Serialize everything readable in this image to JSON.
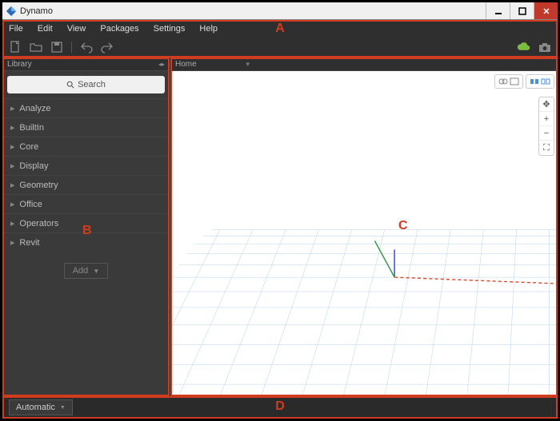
{
  "window": {
    "title": "Dynamo"
  },
  "menus": {
    "file": "File",
    "edit": "Edit",
    "view": "View",
    "packages": "Packages",
    "settings": "Settings",
    "help": "Help"
  },
  "library": {
    "panelTitle": "Library",
    "searchPlaceholder": "Search",
    "items": [
      {
        "label": "Analyze"
      },
      {
        "label": "BuiltIn"
      },
      {
        "label": "Core"
      },
      {
        "label": "Display"
      },
      {
        "label": "Geometry"
      },
      {
        "label": "Office"
      },
      {
        "label": "Operators"
      },
      {
        "label": "Revit"
      }
    ],
    "addLabel": "Add"
  },
  "workspace": {
    "tabTitle": "Home"
  },
  "viewportNav": {
    "pan": "✥",
    "zoomIn": "+",
    "zoomOut": "−",
    "fit": "⛶"
  },
  "statusbar": {
    "runMode": "Automatic"
  },
  "callouts": {
    "A": "A",
    "B": "B",
    "C": "C",
    "D": "D"
  },
  "colors": {
    "calloutRed": "#d13c1e",
    "bgDark": "#2f2f2f",
    "cloudGreen": "#7bbd3f"
  }
}
